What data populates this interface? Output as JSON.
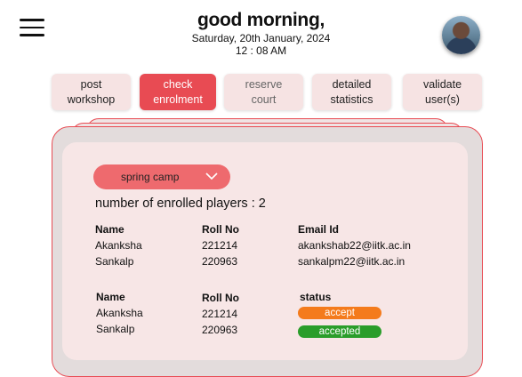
{
  "header": {
    "greeting": "good morning,",
    "date": "Saturday, 20th January, 2024",
    "time": "12 : 08 AM"
  },
  "nav": {
    "post_workshop": [
      "post",
      "workshop"
    ],
    "check_enrolment": [
      "check",
      "enrolment"
    ],
    "reserve_court": [
      "reserve",
      "court"
    ],
    "detailed_statistics": [
      "detailed",
      "statistics"
    ],
    "validate_users": [
      "validate",
      "user(s)"
    ]
  },
  "camp_select": {
    "selected": "spring camp"
  },
  "enrolled": {
    "label": "number of enrolled players",
    "sep": " : ",
    "count": "2"
  },
  "table1": {
    "headers": [
      "Name",
      "Roll No",
      "Email Id"
    ],
    "rows": [
      [
        "Akanksha",
        "221214",
        "akankshab22@iitk.ac.in"
      ],
      [
        "Sankalp",
        "220963",
        "sankalpm22@iitk.ac.in"
      ]
    ]
  },
  "table2": {
    "headers": [
      "Name",
      "Roll No",
      "status"
    ],
    "rows": [
      [
        "Akanksha",
        "221214",
        "accept"
      ],
      [
        "Sankalp",
        "220963",
        "accepted"
      ]
    ]
  },
  "colors": {
    "accent": "#e84b53",
    "accept": "#f47b1c",
    "accepted": "#2a9d2a"
  },
  "icons": {
    "menu": "menu-icon",
    "dropdown": "chevron-down-icon",
    "profile": "avatar"
  }
}
